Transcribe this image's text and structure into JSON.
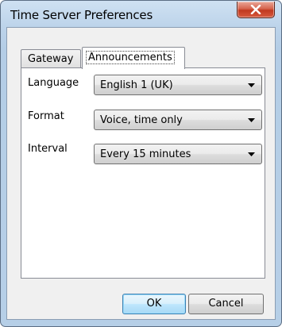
{
  "window": {
    "title": "Time Server Preferences"
  },
  "tabs": [
    {
      "label": "Gateway",
      "selected": false
    },
    {
      "label": "Announcements",
      "selected": true
    }
  ],
  "fields": {
    "language": {
      "label": "Language",
      "value": "English 1 (UK)"
    },
    "format": {
      "label": "Format",
      "value": "Voice, time only"
    },
    "interval": {
      "label": "Interval",
      "value": "Every 15 minutes"
    }
  },
  "buttons": {
    "ok": "OK",
    "cancel": "Cancel"
  },
  "icons": {
    "close": "close-x-icon",
    "dropdown": "chevron-down-icon"
  },
  "colors": {
    "close_button": "#c0391f",
    "title_bar": "#bcd3ea",
    "default_button_border": "#3c7fb1"
  }
}
